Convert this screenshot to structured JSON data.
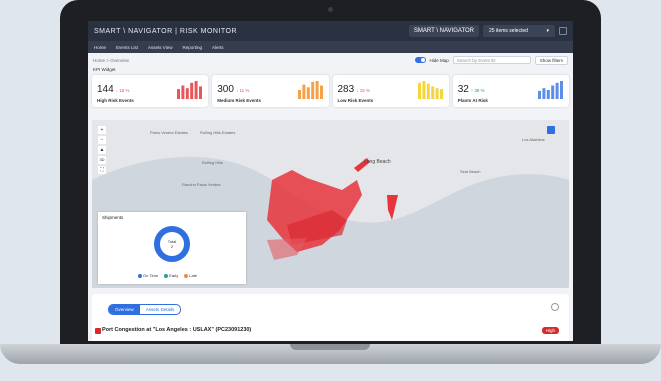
{
  "app": {
    "brand": "SMART \\ NAVIGATOR | RISK MONITOR",
    "brand_pill": "SMART \\ NAVIGATOR",
    "items_selected": "25 items selected"
  },
  "nav": [
    "Home",
    "Events List",
    "Assets View",
    "Reporting",
    "Alerts"
  ],
  "breadcrumb": "Home  >  Overview",
  "controls": {
    "hide_map": "Hide Map",
    "search_placeholder": "Search by Event ID",
    "show_filters": "Show filters"
  },
  "kpi_title": "KPI Widget",
  "kpis": [
    {
      "value": "144",
      "change": "↓ 18 %",
      "label": "High Risk Events",
      "color": "#e8565a",
      "bars": [
        0.55,
        0.75,
        0.6,
        0.9,
        1.0,
        0.7
      ]
    },
    {
      "value": "300",
      "change": "↓ 11 %",
      "label": "Medium Risk Events",
      "color": "#f5a14a",
      "bars": [
        0.5,
        0.8,
        0.65,
        0.95,
        1.0,
        0.75
      ]
    },
    {
      "value": "283",
      "change": "↓ 15 %",
      "label": "Low Risk Events",
      "color": "#f6d43c",
      "bars": [
        0.9,
        1.0,
        0.85,
        0.7,
        0.6,
        0.55
      ]
    },
    {
      "value": "32",
      "change": "↑ 39 %",
      "label": "Plants At Risk",
      "color": "#5c8ee8",
      "bars": [
        0.45,
        0.6,
        0.5,
        0.75,
        0.9,
        1.0
      ]
    }
  ],
  "map": {
    "labels": [
      "Palos Verdes Estates",
      "Rolling Hills Estates",
      "Rolling Hills",
      "Rancho Palos Verdes",
      "Long Beach",
      "Seal Beach",
      "Los Alamitos"
    ]
  },
  "shipments": {
    "title": "Shipments",
    "center_label": "Total",
    "center_value": "2",
    "legend": [
      {
        "label": "On Time",
        "color": "#2f6fe0"
      },
      {
        "label": "Early",
        "color": "#21a39a"
      },
      {
        "label": "Late",
        "color": "#f08a3a"
      }
    ]
  },
  "tabs": [
    "Overview",
    "Assets Details"
  ],
  "event": {
    "title": "Port Congestion at \"Los Angeles : USLAX\" (PC23091230)",
    "badge": "High"
  }
}
